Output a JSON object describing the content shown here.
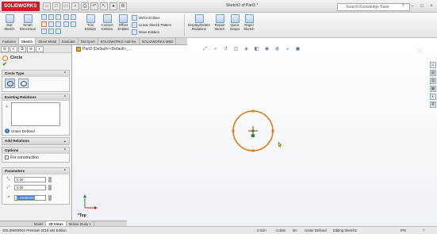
{
  "app": {
    "logo": "SOLIDWORKS",
    "document_title": "Sketch2 of Part3 *",
    "search_placeholder": "Search Knowledge Base",
    "quick_access": [
      "file",
      "new",
      "open",
      "save",
      "print",
      "undo",
      "select",
      "rebuild",
      "options"
    ]
  },
  "command_manager": {
    "exit_sketch": "Exit Sketch",
    "smart_dimension": "Smart Dimension",
    "trim_entities": "Trim Entities",
    "convert_entities": "Convert Entities",
    "offset_entities": "Offset Entities",
    "mirror_entities": "Mirror Entities",
    "linear_sketch_pattern": "Linear Sketch Pattern",
    "move_entities": "Move Entities",
    "display_delete_relations": "Display/Delete Relations",
    "repair_sketch": "Repair Sketch",
    "quick_snaps": "Quick Snaps",
    "rapid_sketch": "Rapid Sketch"
  },
  "tabs": [
    "Features",
    "Sketch",
    "Sheet Metal",
    "Evaluate",
    "DimXpert",
    "SOLIDWORKS Add-Ins",
    "SOLIDWORKS MBD"
  ],
  "active_tab": "Sketch",
  "property_manager": {
    "title": "Circle",
    "circle_type_header": "Circle Type",
    "existing_relations_header": "Existing Relations",
    "status": "Under Defined",
    "add_relations_header": "Add Relations",
    "options_header": "Options",
    "for_construction": "For construction",
    "parameters_header": "Parameters",
    "param_x": "0.00",
    "param_y": "0.00",
    "param_radius": "1.00000000"
  },
  "graphics": {
    "tree_item": "Part3 (Default<<Default>_...",
    "view_label": "*Top"
  },
  "bottom_tabs": [
    "Model",
    "3D Views",
    "Motion Study 1"
  ],
  "active_bottom_tab": "Model",
  "status_bar": {
    "product": "SOLIDWORKS Premium 2015 x64 Edition",
    "x_coord": "0.01in",
    "y_coord": "-0.36in",
    "z_coord": "0in",
    "definition": "Under Defined",
    "editing": "Editing Sketch2",
    "units": "IPS"
  },
  "colors": {
    "sketch_circle": "#e07b1a",
    "center_point": "#2e8b2e",
    "logo": "#c8202a"
  }
}
